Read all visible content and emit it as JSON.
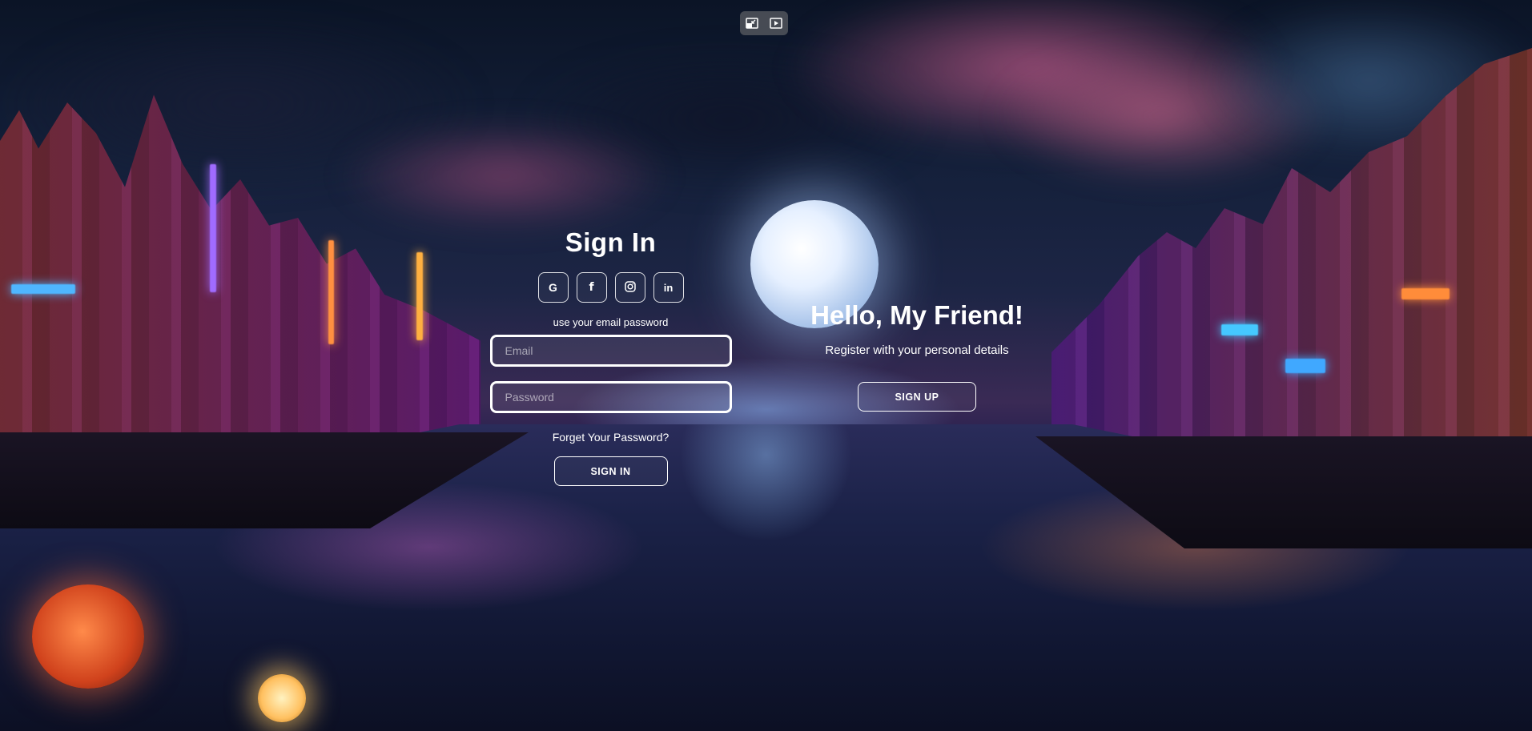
{
  "top_controls": {
    "icons": [
      "minimize-window-icon",
      "video-play-icon"
    ]
  },
  "sign_in": {
    "title": "Sign In",
    "social": [
      {
        "name": "google",
        "glyph": "G"
      },
      {
        "name": "facebook",
        "glyph": "f"
      },
      {
        "name": "instagram",
        "glyph": "◎"
      },
      {
        "name": "linkedin",
        "glyph": "in"
      }
    ],
    "hint": "use your email password",
    "email_placeholder": "Email",
    "password_placeholder": "Password",
    "forgot_label": "Forget Your Password?",
    "button_label": "SIGN IN"
  },
  "welcome": {
    "title": "Hello, My Friend!",
    "subtitle": "Register with your personal details",
    "button_label": "SIGN UP"
  },
  "colors": {
    "text": "#ffffff",
    "field_border": "#ffffff"
  }
}
